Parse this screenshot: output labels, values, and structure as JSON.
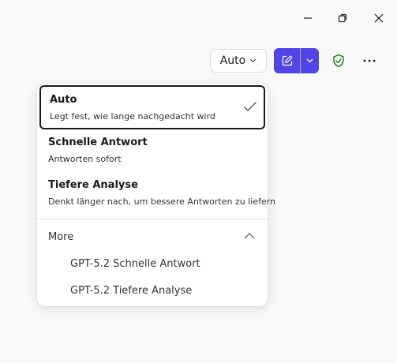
{
  "window_controls": {
    "minimize_icon": "minimize-icon",
    "restore_icon": "restore-icon",
    "close_icon": "close-icon"
  },
  "toolbar": {
    "mode_label": "Auto",
    "accent_color": "#4f46e5",
    "shield_color": "#0f7b0f"
  },
  "menu": {
    "options": [
      {
        "title": "Auto",
        "description": "Legt fest, wie lange nachgedacht wird",
        "selected": true
      },
      {
        "title": "Schnelle Antwort",
        "description": "Antworten sofort",
        "selected": false
      },
      {
        "title": "Tiefere Analyse",
        "description": "Denkt länger nach, um bessere Antworten zu liefern",
        "selected": false
      }
    ],
    "more_label": "More",
    "more_expanded": true,
    "more_items": [
      "GPT-5.2 Schnelle Antwort",
      "GPT-5.2 Tiefere Analyse"
    ]
  }
}
